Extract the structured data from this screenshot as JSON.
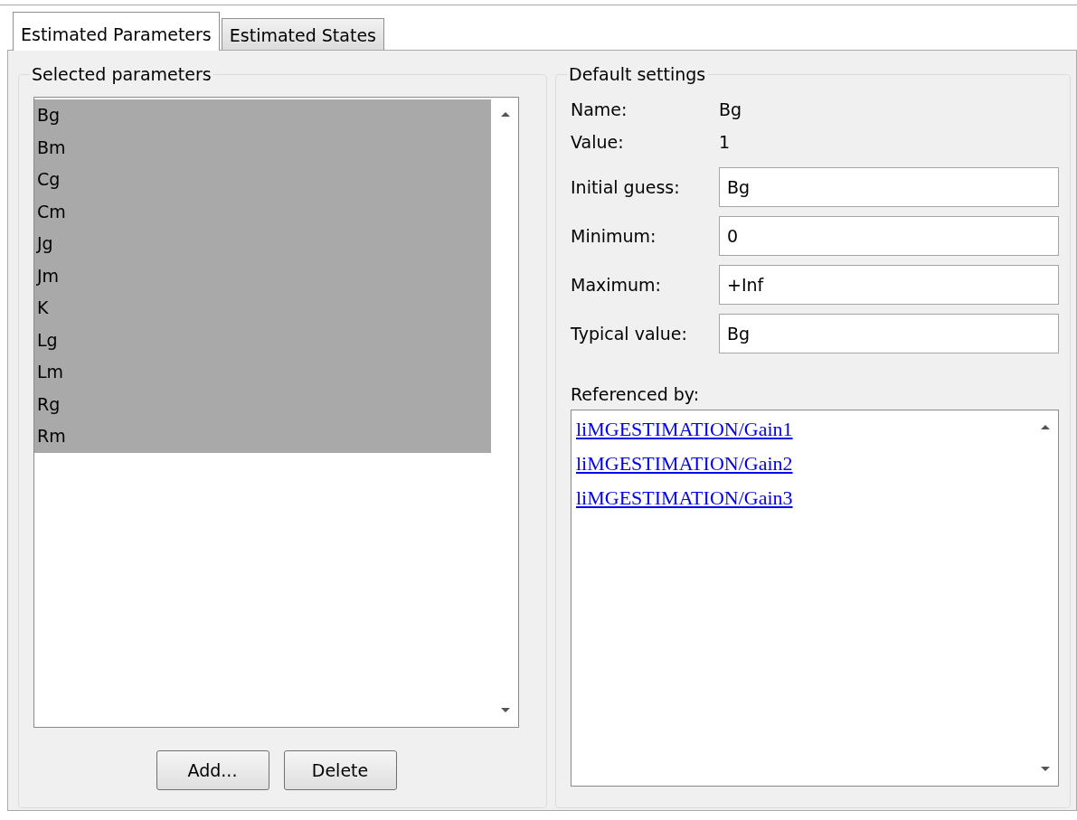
{
  "tabs": [
    {
      "label": "Estimated Parameters",
      "selected": true
    },
    {
      "label": "Estimated States",
      "selected": false
    }
  ],
  "selected_parameters": {
    "title": "Selected parameters",
    "items": [
      {
        "label": "Bg",
        "selected": true
      },
      {
        "label": "Bm",
        "selected": true
      },
      {
        "label": "Cg",
        "selected": true
      },
      {
        "label": "Cm",
        "selected": true
      },
      {
        "label": "Jg",
        "selected": true
      },
      {
        "label": "Jm",
        "selected": true
      },
      {
        "label": "K",
        "selected": true
      },
      {
        "label": "Lg",
        "selected": true
      },
      {
        "label": "Lm",
        "selected": true
      },
      {
        "label": "Rg",
        "selected": true
      },
      {
        "label": "Rm",
        "selected": true
      }
    ],
    "buttons": [
      "Add...",
      "Delete"
    ]
  },
  "default_settings": {
    "title": "Default settings",
    "info": [
      {
        "label": "Name:",
        "value": "Bg"
      },
      {
        "label": "Value:",
        "value": "1"
      }
    ],
    "fields": [
      {
        "label": "Initial guess:",
        "value": "Bg"
      },
      {
        "label": "Minimum:",
        "value": "0"
      },
      {
        "label": "Maximum:",
        "value": "+Inf"
      },
      {
        "label": "Typical value:",
        "value": "Bg"
      }
    ],
    "referenced_by": {
      "title": "Referenced by:",
      "links": [
        "liMGESTIMATION/Gain1",
        "liMGESTIMATION/Gain2",
        "liMGESTIMATION/Gain3"
      ]
    }
  }
}
